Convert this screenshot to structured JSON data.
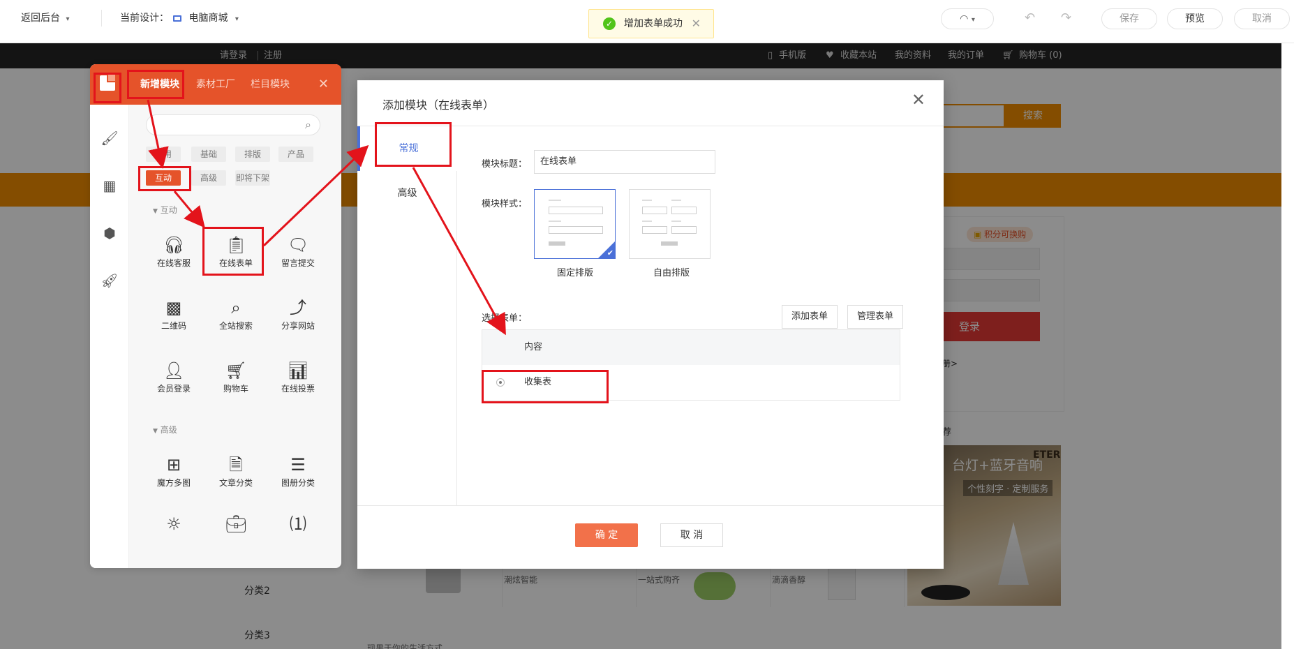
{
  "topbar": {
    "back_label": "返回后台",
    "design_label": "当前设计：",
    "design_value": "电脑商城",
    "save_label": "保存",
    "preview_label": "预览",
    "cancel_label": "取消"
  },
  "toast": {
    "message": "增加表单成功"
  },
  "site_nav": {
    "login": "请登录",
    "register": "注册",
    "mobile": "手机版",
    "favorite": "收藏本站",
    "profile": "我的资料",
    "orders": "我的订单",
    "cart": "购物车 (0)"
  },
  "site": {
    "search_btn": "搜索",
    "points_badge": "积分可换购",
    "login_btn": "登录",
    "register_link": "册>",
    "recommend": "荐",
    "promo_title": "台灯+蓝牙音响",
    "promo_sub": "个性刻字 · 定制服务",
    "promo_brand": "ETER",
    "categories": [
      "分类2",
      "分类3"
    ],
    "products": [
      "潮炫智能",
      "一站式购齐",
      "滴滴香醇"
    ],
    "footer_text": "现果于你的生活方式"
  },
  "panel": {
    "tabs": [
      "新增模块",
      "素材工厂",
      "栏目模块"
    ],
    "chips_row1": [
      "常用",
      "基础",
      "排版",
      "产品"
    ],
    "chips_row2": [
      "互动",
      "高级",
      "即将下架"
    ],
    "section_interact": "互动",
    "section_advanced": "高级",
    "modules_interact": [
      "在线客服",
      "在线表单",
      "留言提交",
      "二维码",
      "全站搜索",
      "分享网站",
      "会员登录",
      "购物车",
      "在线投票"
    ],
    "modules_advanced": [
      "魔方多图",
      "文章分类",
      "图册分类"
    ]
  },
  "dialog": {
    "title": "添加模块（在线表单）",
    "tabs": [
      "常规",
      "高级"
    ],
    "title_label": "模块标题：",
    "title_value": "在线表单",
    "style_label": "模块样式：",
    "styles": [
      "固定排版",
      "自由排版"
    ],
    "select_label": "选择表单：",
    "add_form_btn": "添加表单",
    "manage_form_btn": "管理表单",
    "table_header": "内容",
    "table_row": "收集表",
    "ok_btn": "确 定",
    "cancel_btn": "取 消"
  },
  "colors": {
    "accent": "#e5532a",
    "primary_blue": "#4a70d8",
    "annotation_red": "#e3131b",
    "site_orange": "#f08c00"
  }
}
